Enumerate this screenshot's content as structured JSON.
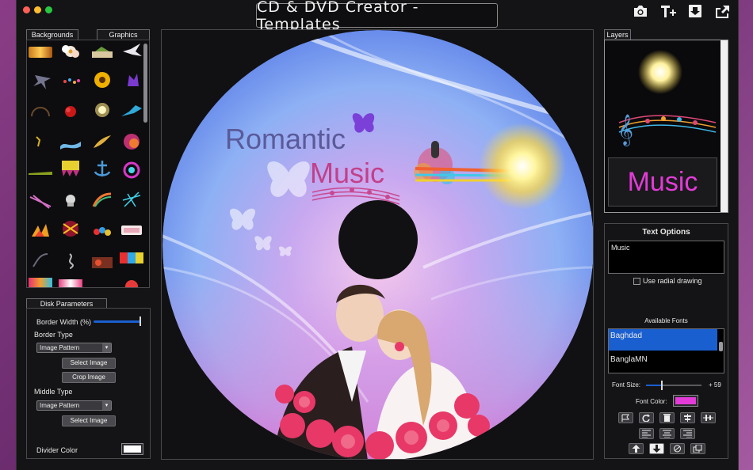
{
  "window": {
    "title": "CD & DVD Creator - Templates"
  },
  "toolbar": {
    "icons": [
      "camera-icon",
      "add-text-icon",
      "download-icon",
      "share-icon"
    ]
  },
  "left_tabs": {
    "backgrounds": "Backgrounds",
    "graphics": "Graphics"
  },
  "disk_parameters": {
    "tab_label": "Disk Parameters",
    "border_width_label": "Border Width (%)",
    "border_type_label": "Border Type",
    "border_type_value": "Image Pattern",
    "select_image_label": "Select Image",
    "crop_image_label": "Crop Image",
    "middle_type_label": "Middle Type",
    "middle_type_value": "Image Pattern",
    "middle_select_image_label": "Select Image",
    "divider_color_label": "Divider Color",
    "divider_color": "#ffffff"
  },
  "disc": {
    "title_line1": "Romantic",
    "title_line2": "Music",
    "title_color1": "#5a5a9a",
    "title_color2": "#c2408a"
  },
  "layers": {
    "tab_label": "Layers",
    "text_layer": "Music",
    "text_layer_color": "#e23bd8"
  },
  "text_options": {
    "title": "Text Options",
    "text_value": "Music",
    "radial_label": "Use radial drawing",
    "radial_checked": false,
    "available_fonts_label": "Available Fonts",
    "fonts": [
      "Baghdad",
      "BanglaMN"
    ],
    "selected_font": "Baghdad",
    "font_size_label": "Font Size:",
    "font_size_value": "+ 59",
    "font_color_label": "Font Color:",
    "font_color": "#e23bd8"
  },
  "colors": {
    "accent_selection": "#1a5fd0",
    "window_bg": "#141416"
  }
}
